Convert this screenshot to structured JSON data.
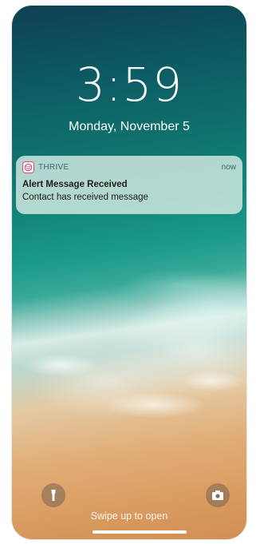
{
  "lock_screen": {
    "time": "3:59",
    "date": "Monday, November 5",
    "swipe_hint": "Swipe up to open"
  },
  "notification": {
    "app_icon": "thrive-app-icon",
    "app_name": "THRIVE",
    "time": "now",
    "title": "Alert Message Received",
    "body": "Contact has received message"
  },
  "controls": {
    "left_icon": "flashlight-icon",
    "right_icon": "camera-icon"
  },
  "colors": {
    "notification_bg": "#d6ece4",
    "app_name_color": "#3a6a63",
    "app_icon_border": "#d24c7a"
  }
}
